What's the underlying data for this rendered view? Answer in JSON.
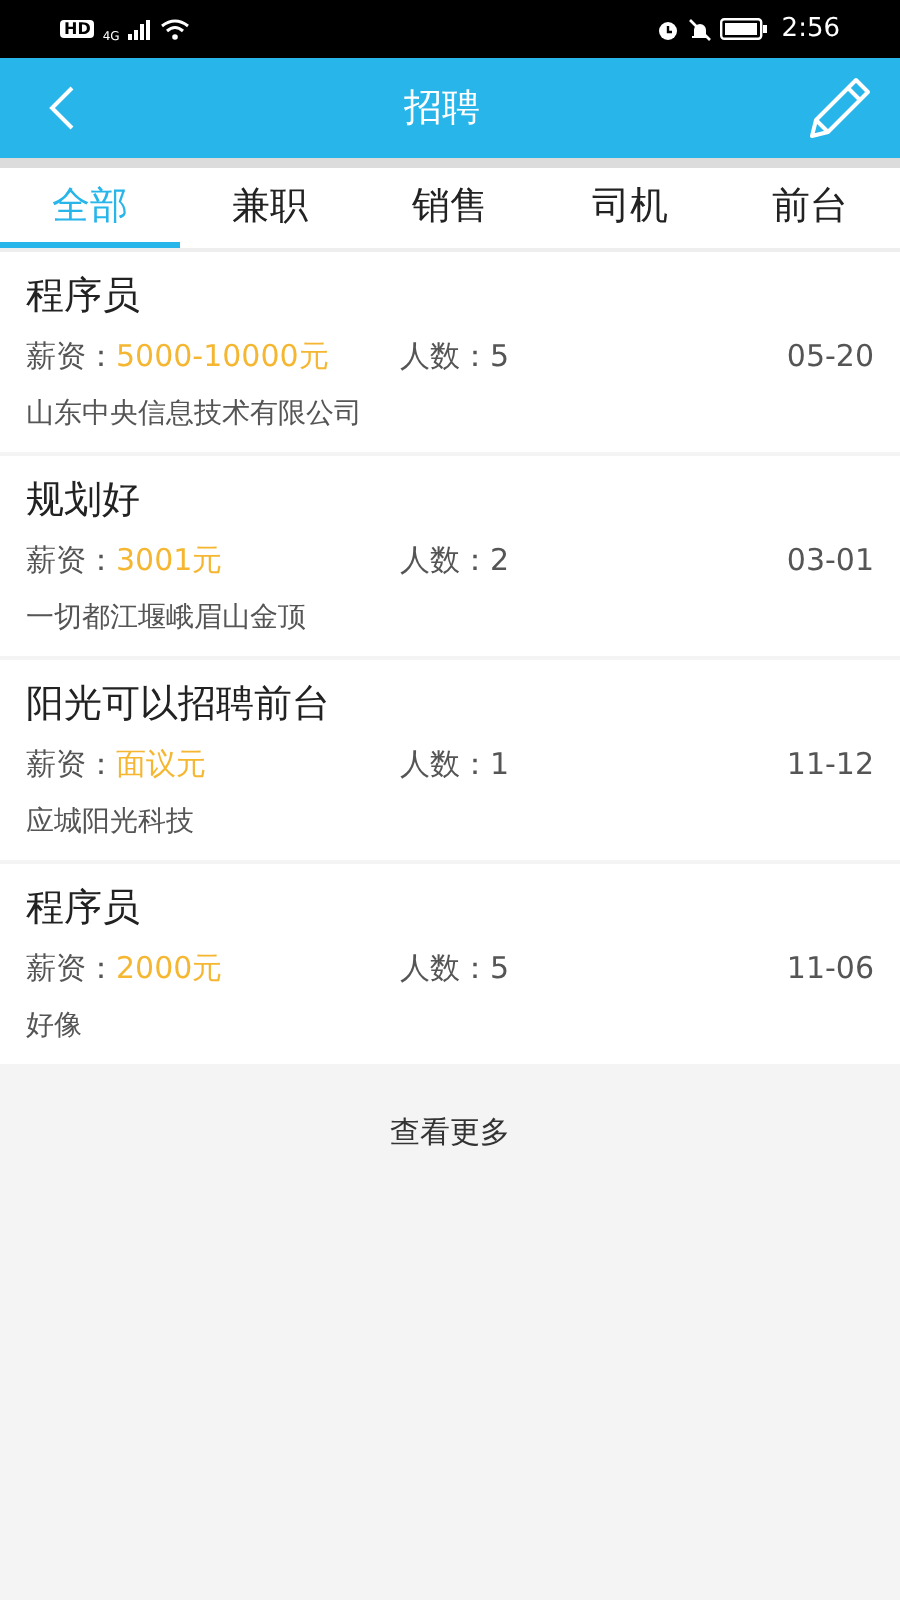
{
  "status_bar": {
    "hd": "HD",
    "network": "4G",
    "time": "2:56"
  },
  "header": {
    "title": "招聘"
  },
  "tabs": [
    {
      "label": "全部",
      "selected": true
    },
    {
      "label": "兼职",
      "selected": false
    },
    {
      "label": "销售",
      "selected": false
    },
    {
      "label": "司机",
      "selected": false
    },
    {
      "label": "前台",
      "selected": false
    }
  ],
  "jobs": [
    {
      "title": "程序员",
      "salary_label": "薪资：",
      "salary": "5000-10000元",
      "count_label": "人数：",
      "count": "5",
      "date": "05-20",
      "company": "山东中央信息技术有限公司"
    },
    {
      "title": "规划好",
      "salary_label": "薪资：",
      "salary": "3001元",
      "count_label": "人数：",
      "count": "2",
      "date": "03-01",
      "company": "一切都江堰峨眉山金顶"
    },
    {
      "title": "阳光可以招聘前台",
      "salary_label": "薪资：",
      "salary": "面议元",
      "count_label": "人数：",
      "count": "1",
      "date": "11-12",
      "company": "应城阳光科技"
    },
    {
      "title": "程序员",
      "salary_label": "薪资：",
      "salary": "2000元",
      "count_label": "人数：",
      "count": "5",
      "date": "11-06",
      "company": "好像"
    }
  ],
  "load_more": "查看更多"
}
